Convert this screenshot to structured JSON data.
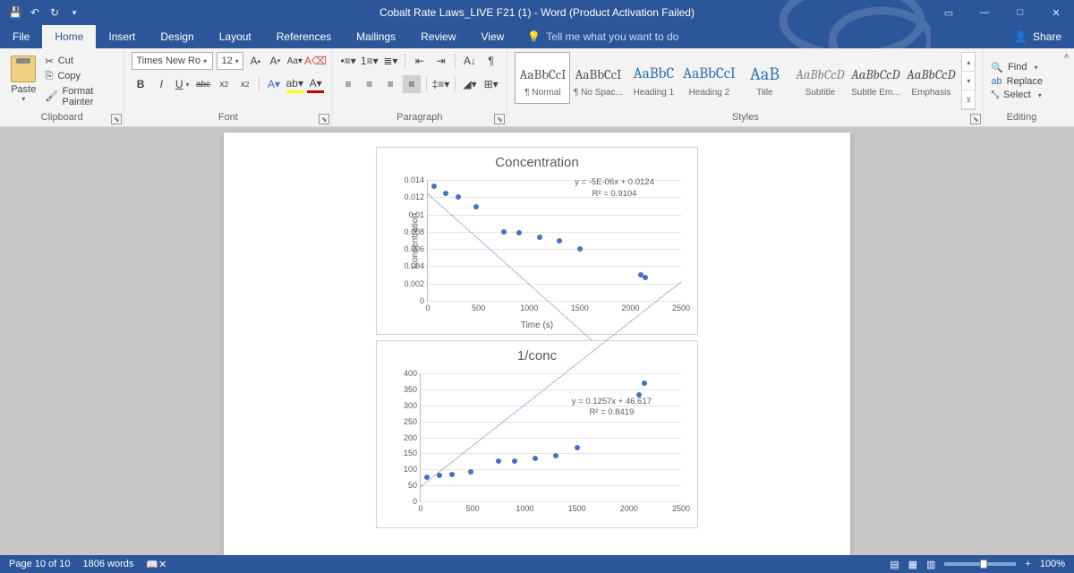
{
  "title": "Cobalt Rate Laws_LIVE F21 (1) - Word (Product Activation Failed)",
  "menu": {
    "file": "File",
    "home": "Home",
    "insert": "Insert",
    "design": "Design",
    "layout": "Layout",
    "references": "References",
    "mailings": "Mailings",
    "review": "Review",
    "view": "View",
    "tell": "Tell me what you want to do",
    "share": "Share"
  },
  "clipboard": {
    "group": "Clipboard",
    "paste": "Paste",
    "cut": "Cut",
    "copy": "Copy",
    "painter": "Format Painter"
  },
  "font": {
    "group": "Font",
    "name": "Times New Ro",
    "size": "12"
  },
  "paragraph": {
    "group": "Paragraph"
  },
  "styles": {
    "group": "Styles",
    "items": [
      {
        "prev": "AaBbCcI",
        "label": "¶ Normal"
      },
      {
        "prev": "AaBbCcI",
        "label": "¶ No Spac..."
      },
      {
        "prev": "AaBbC",
        "label": "Heading 1"
      },
      {
        "prev": "AaBbCcI",
        "label": "Heading 2"
      },
      {
        "prev": "AaB",
        "label": "Title"
      },
      {
        "prev": "AaBbCcD",
        "label": "Subtitle"
      },
      {
        "prev": "AaBbCcD",
        "label": "Subtle Em..."
      },
      {
        "prev": "AaBbCcD",
        "label": "Emphasis"
      }
    ]
  },
  "editing": {
    "group": "Editing",
    "find": "Find",
    "replace": "Replace",
    "select": "Select"
  },
  "status": {
    "page": "Page 10 of 10",
    "words": "1806 words",
    "zoom": "100%"
  },
  "chart_data": [
    {
      "type": "scatter",
      "title": "Concentration",
      "xlabel": "Time (s)",
      "ylabel": "Concentration",
      "xlim": [
        0,
        2500
      ],
      "ylim": [
        0,
        0.014
      ],
      "xticks": [
        0,
        500,
        1000,
        1500,
        2000,
        2500
      ],
      "yticks": [
        0,
        0.002,
        0.004,
        0.006,
        0.008,
        0.01,
        0.012,
        0.014
      ],
      "equation": "y = -5E-06x + 0.0124",
      "r2": "R² = 0.9104",
      "series": [
        {
          "name": "Concentration",
          "x": [
            60,
            180,
            300,
            480,
            750,
            900,
            1100,
            1300,
            1500,
            2100,
            2150
          ],
          "y": [
            0.0133,
            0.0124,
            0.012,
            0.0109,
            0.008,
            0.0079,
            0.0074,
            0.007,
            0.006,
            0.003,
            0.0027
          ]
        }
      ],
      "trend": {
        "slope": -5e-06,
        "intercept": 0.0124
      }
    },
    {
      "type": "scatter",
      "title": "1/conc",
      "xlabel": "",
      "ylabel": "",
      "xlim": [
        0,
        2500
      ],
      "ylim": [
        0,
        400
      ],
      "xticks": [
        0,
        500,
        1000,
        1500,
        2000,
        2500
      ],
      "yticks": [
        0,
        50,
        100,
        150,
        200,
        250,
        300,
        350,
        400
      ],
      "equation": "y = 0.1257x + 46.617",
      "r2": "R² = 0.8419",
      "series": [
        {
          "name": "1/conc",
          "x": [
            60,
            180,
            300,
            480,
            750,
            900,
            1100,
            1300,
            1500,
            2100,
            2150
          ],
          "y": [
            75,
            81,
            83,
            92,
            125,
            127,
            135,
            143,
            167,
            333,
            370
          ]
        }
      ],
      "trend": {
        "slope": 0.1257,
        "intercept": 46.617
      }
    }
  ]
}
